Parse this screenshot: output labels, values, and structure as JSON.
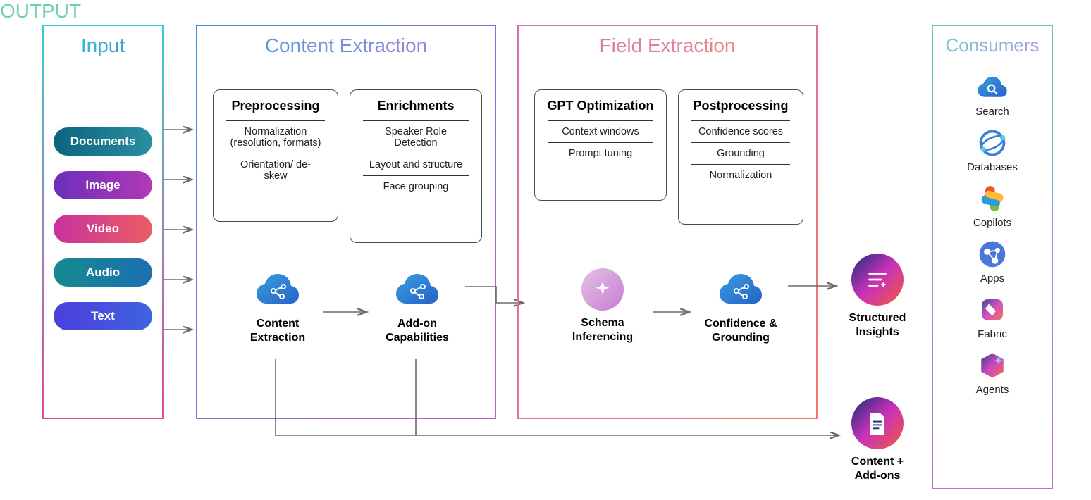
{
  "input": {
    "title": "Input",
    "pills": [
      "Documents",
      "Image",
      "Video",
      "Audio",
      "Text"
    ]
  },
  "content": {
    "title": "Content Extraction",
    "preprocessing": {
      "title": "Preprocessing",
      "items": [
        "Normalization (resolution, formats)",
        "Orientation/ de-skew"
      ]
    },
    "enrichments": {
      "title": "Enrichments",
      "items": [
        "Speaker Role Detection",
        "Layout and structure",
        "Face grouping"
      ]
    },
    "node1": "Content Extraction",
    "node2": "Add-on Capabilities"
  },
  "field": {
    "title": "Field Extraction",
    "gpt": {
      "title": "GPT Optimization",
      "items": [
        "Context windows",
        "Prompt tuning"
      ]
    },
    "post": {
      "title": "Postprocessing",
      "items": [
        "Confidence scores",
        "Grounding",
        "Normalization"
      ]
    },
    "node1": "Schema Inferencing",
    "node2": "Confidence & Grounding"
  },
  "output": {
    "title": "OUTPUT",
    "node1": "Structured Insights",
    "node2": "Content + Add-ons"
  },
  "consumers": {
    "title": "Consumers",
    "items": [
      {
        "label": "Search",
        "icon": "search-cloud-icon"
      },
      {
        "label": "Databases",
        "icon": "databases-icon"
      },
      {
        "label": "Copilots",
        "icon": "copilot-icon"
      },
      {
        "label": "Apps",
        "icon": "apps-icon"
      },
      {
        "label": "Fabric",
        "icon": "fabric-icon"
      },
      {
        "label": "Agents",
        "icon": "agents-icon"
      }
    ]
  }
}
